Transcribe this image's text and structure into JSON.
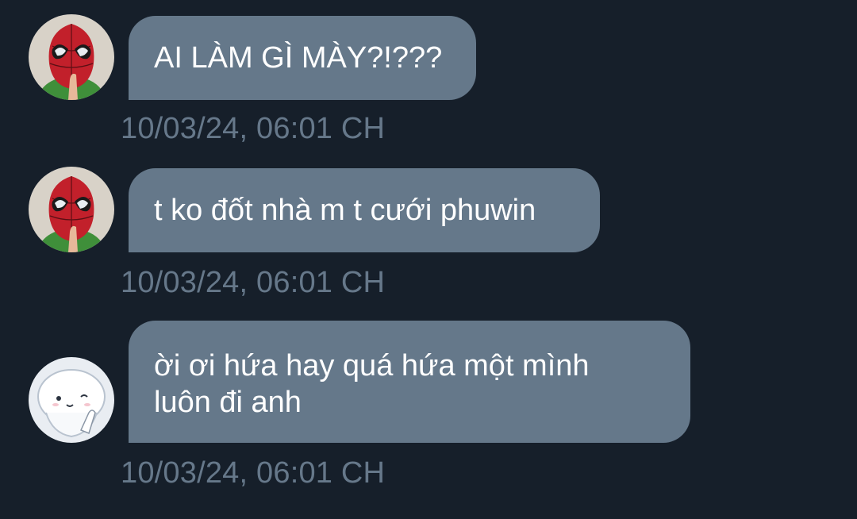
{
  "messages": [
    {
      "avatar": "spiderman-mask-avatar",
      "lines": [
        "AI LÀM GÌ MÀY?!???"
      ],
      "timestamp": "10/03/24, 06:01 CH"
    },
    {
      "avatar": "spiderman-mask-avatar",
      "lines": [
        "t ko đốt nhà m t cưới phuwin"
      ],
      "timestamp": "10/03/24, 06:01 CH"
    },
    {
      "avatar": "white-mascot-avatar",
      "lines": [
        "ời ơi hứa hay quá hứa một mình",
        "luôn đi anh"
      ],
      "timestamp": "10/03/24, 06:01 CH"
    }
  ],
  "colors": {
    "background": "#161f2a",
    "bubble": "#65788a",
    "bubble_text": "#ffffff",
    "timestamp": "#66788a"
  }
}
